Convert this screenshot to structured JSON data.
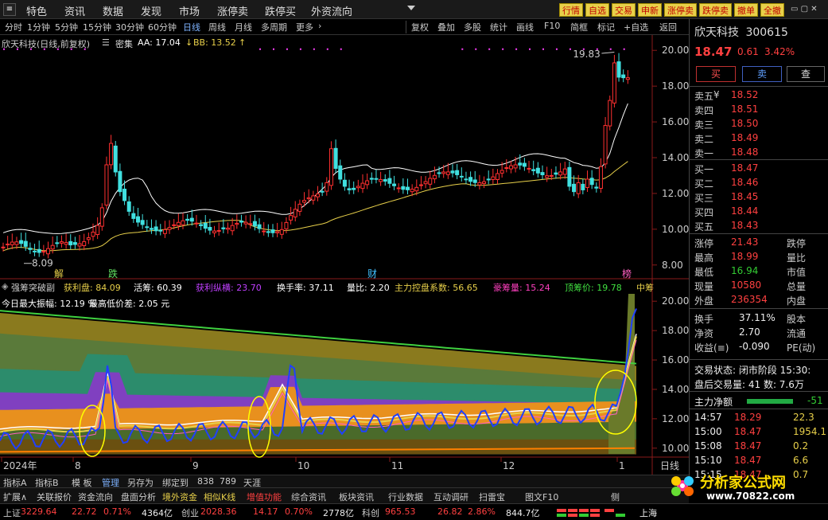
{
  "menu": {
    "items": [
      "特色",
      "资讯",
      "数据",
      "发现",
      "市场",
      "涨停卖",
      "跌停买",
      "外资流向"
    ],
    "buttons": [
      "行情",
      "自选",
      "交易",
      "申新",
      "涨停卖",
      "跌停卖",
      "撤单",
      "全撤"
    ]
  },
  "toolbar": {
    "periods": [
      "分时",
      "1分钟",
      "5分钟",
      "15分钟",
      "30分钟",
      "60分钟",
      "日线",
      "周线",
      "月线",
      "多周期",
      "更多"
    ],
    "tools": [
      "复权",
      "叠加",
      "多股",
      "统计",
      "画线",
      "F10",
      "简框",
      "标记",
      "+自选",
      "返回"
    ]
  },
  "price_legend": {
    "title": "欣天科技(日线,前复权)",
    "dense": "密集",
    "aa": "AA: 17.04",
    "bb": "BB: 13.52"
  },
  "chart_data": {
    "type": "candlestick",
    "title": "欣天科技(日线,前复权)",
    "ylim": [
      7.5,
      20.5
    ],
    "yticks": [
      "20.00",
      "18.00",
      "16.00",
      "14.00",
      "12.00",
      "10.00",
      "8.00"
    ],
    "xticks": [
      "2024年",
      "8",
      "9",
      "10",
      "11",
      "12",
      "1"
    ],
    "annotations": [
      "19.83",
      "8.09"
    ],
    "markers": [
      "解",
      "跌",
      "财",
      "榜"
    ],
    "period_label": "日线"
  },
  "indicator_legend": {
    "name": "强筹突破副",
    "items": [
      {
        "label": "获利盘: 84.09",
        "color": "#e8d04a"
      },
      {
        "label": "活筹: 60.39",
        "color": "#ffffff"
      },
      {
        "label": "获利纵横: 23.70",
        "color": "#c040ff"
      },
      {
        "label": "换手率: 37.11",
        "color": "#ffffff"
      },
      {
        "label": "量比: 2.20",
        "color": "#ffffff"
      },
      {
        "label": "主力控盘系数: 56.65",
        "color": "#e8d04a"
      },
      {
        "label": "豪筹量: 15.24",
        "color": "#ff40c0"
      },
      {
        "label": "顶筹价: 19.78",
        "color": "#40e040"
      },
      {
        "label": "中筹",
        "color": "#e8d04a"
      }
    ],
    "line2": "今日最大振幅: 12.19 %",
    "line2b": "最高低价差: 2.05 元"
  },
  "indicator_axis": [
    "20.00",
    "18.00",
    "16.00",
    "14.00",
    "12.00",
    "10.00"
  ],
  "quote": {
    "name": "欣天科技",
    "code": "300615",
    "price": "18.47",
    "change": "0.61",
    "pct": "3.42%",
    "buttons": [
      "买",
      "卖",
      "查"
    ],
    "asks": [
      {
        "label": "卖五",
        "price": "18.52"
      },
      {
        "label": "卖四",
        "price": "18.51"
      },
      {
        "label": "卖三",
        "price": "18.50"
      },
      {
        "label": "卖二",
        "price": "18.49"
      },
      {
        "label": "卖一",
        "price": "18.48"
      }
    ],
    "bids": [
      {
        "label": "买一",
        "price": "18.47"
      },
      {
        "label": "买二",
        "price": "18.46"
      },
      {
        "label": "买三",
        "price": "18.45"
      },
      {
        "label": "买四",
        "price": "18.44"
      },
      {
        "label": "买五",
        "price": "18.43"
      }
    ],
    "ask_unit": "¥",
    "stats": [
      {
        "l": "涨停",
        "v": "21.43",
        "l2": "跌停"
      },
      {
        "l": "最高",
        "v": "18.99",
        "l2": "量比"
      },
      {
        "l": "最低",
        "v": "16.94",
        "l2": "市值"
      },
      {
        "l": "现量",
        "v": "10580",
        "l2": "总量"
      },
      {
        "l": "外盘",
        "v": "236354",
        "l2": "内盘"
      }
    ],
    "stats2": [
      {
        "l": "换手",
        "v": "37.11%",
        "l2": "股本"
      },
      {
        "l": "净资",
        "v": "2.70",
        "l2": "流通"
      },
      {
        "l": "收益(≡)",
        "v": "-0.090",
        "l2": "PE(动)"
      }
    ],
    "trade_state": "交易状态: 闭市阶段 15:30:",
    "after_hours": "盘后交易量: 41  数: 7.6万",
    "net_label": "主力净额",
    "net_value": "-51",
    "ticks": [
      {
        "t": "14:57",
        "p": "18.29",
        "v": "22.3"
      },
      {
        "t": "15:00",
        "p": "18.47",
        "v": "1954.1"
      },
      {
        "t": "15:08",
        "p": "18.47",
        "v": "0.2"
      },
      {
        "t": "15:10",
        "p": "18.47",
        "v": "6.6"
      },
      {
        "t": "15:15",
        "p": "18.47",
        "v": "0.7"
      }
    ]
  },
  "bottom_tabs": [
    "指标A",
    "指标B",
    "模 板",
    "管理",
    "另存为",
    "绑定到",
    "838",
    "789",
    "天涯"
  ],
  "bottom_bar": [
    "扩展∧",
    "关联报价",
    "资金流向",
    "盘面分析",
    "境外资金",
    "相似K线",
    "增值功能",
    "综合资讯",
    "板块资讯",
    "行业数据",
    "互动调研",
    "扫雷宝",
    "图文F10",
    "侧"
  ],
  "status": {
    "sh_label": "上证",
    "sh_val": "3229.64",
    "sh_chg": "22.72",
    "sh_pct": "0.71%",
    "sh_amt": "4364亿",
    "cy_label": "创业",
    "cy_val": "2028.36",
    "cy_chg": "14.17",
    "cy_pct": "0.70%",
    "cy_amt": "2778亿",
    "kc_label": "科创",
    "kc_val": "965.53",
    "kc_chg": "26.82",
    "kc_pct": "2.86%",
    "kc_amt": "844.7亿",
    "sh2": "上海"
  },
  "ad": {
    "text": "分析家公式网",
    "url": "www.70822.com"
  }
}
